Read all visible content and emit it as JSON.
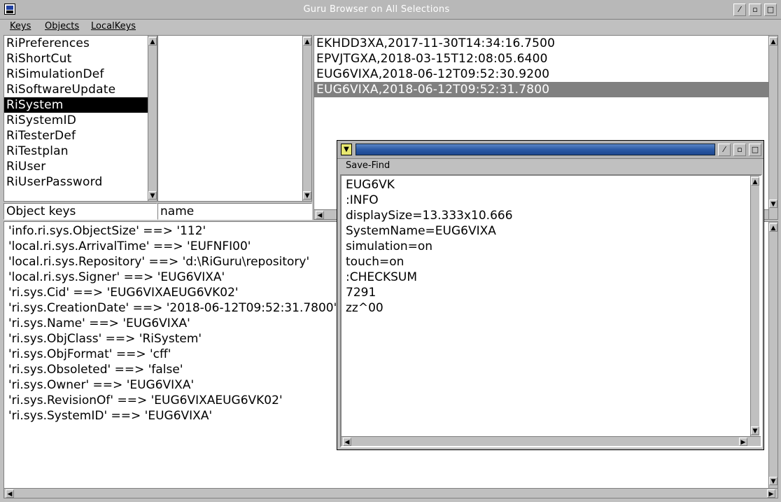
{
  "window": {
    "title": "Guru Browser on  All Selections",
    "buttons": {
      "pencil": "⁄",
      "small": "▫",
      "big": "□"
    }
  },
  "menu": {
    "keys": "Keys",
    "objects": "Objects",
    "localkeys": "LocalKeys"
  },
  "classes": [
    "RiPreferences",
    "RiShortCut",
    "RiSimulationDef",
    "RiSoftwareUpdate",
    "RiSystem",
    "RiSystemID",
    "RiTesterDef",
    "RiTestplan",
    "RiUser",
    "RiUserPassword"
  ],
  "headers": {
    "object_keys": "Object keys",
    "name": "name"
  },
  "objects": [
    "EKHDD3XA,2017-11-30T14:34:16.7500",
    "EPVJTGXA,2018-03-15T12:08:05.6400",
    "EUG6VIXA,2018-06-12T09:52:30.9200",
    "EUG6VIXA,2018-06-12T09:52:31.7800"
  ],
  "properties": [
    "'info.ri.sys.ObjectSize' ==> '112'",
    "'local.ri.sys.ArrivalTime' ==> 'EUFNFI00'",
    "'local.ri.sys.Repository' ==> 'd:\\RiGuru\\repository'",
    "'local.ri.sys.Signer' ==> 'EUG6VIXA'",
    "'ri.sys.Cid' ==> 'EUG6VIXAEUG6VK02'",
    "'ri.sys.CreationDate' ==> '2018-06-12T09:52:31.7800'",
    "'ri.sys.Name' ==> 'EUG6VIXA'",
    "'ri.sys.ObjClass' ==> 'RiSystem'",
    "'ri.sys.ObjFormat' ==> 'cff'",
    "'ri.sys.Obsoleted' ==> 'false'",
    "'ri.sys.Owner' ==> 'EUG6VIXA'",
    "'ri.sys.RevisionOf' ==> 'EUG6VIXAEUG6VK02'",
    "'ri.sys.SystemID' ==> 'EUG6VIXA'"
  ],
  "popup": {
    "menu": "Save-Find",
    "lines": [
      "EUG6VK",
      ":INFO",
      "displaySize=13.333x10.666",
      "SystemName=EUG6VIXA",
      "simulation=on",
      "touch=on",
      ":CHECKSUM",
      "7291",
      "zz^00"
    ]
  },
  "icons": {
    "up": "▲",
    "down": "▼",
    "left": "◀",
    "right": "▶"
  }
}
